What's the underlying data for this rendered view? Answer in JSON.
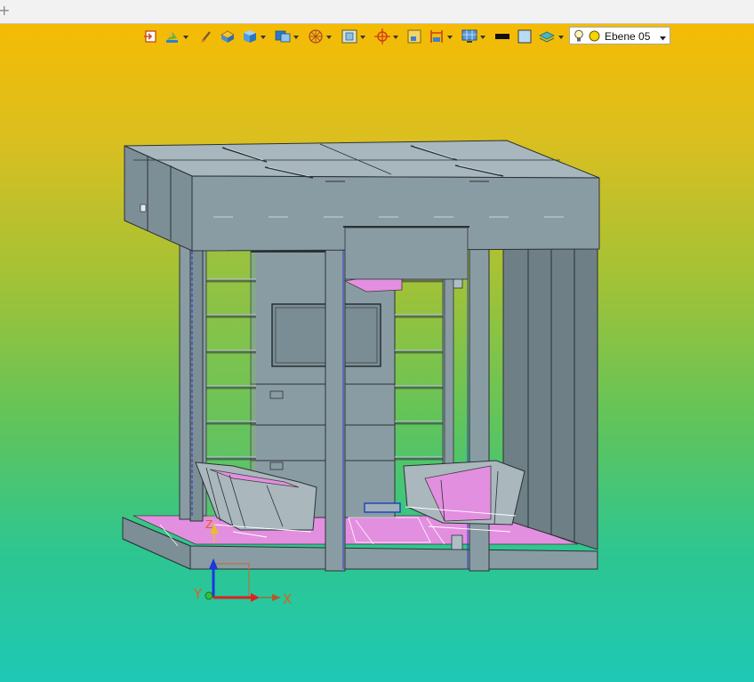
{
  "window": {
    "tab_plus_symbol": "+"
  },
  "toolbar": {
    "tools": [
      {
        "icon": "import-icon",
        "has_dropdown": false
      },
      {
        "icon": "palette-icon",
        "has_dropdown": true
      },
      {
        "icon": "brush-icon",
        "has_dropdown": false
      },
      {
        "icon": "layer-box-icon",
        "has_dropdown": false
      },
      {
        "icon": "cube-icon",
        "has_dropdown": true
      },
      {
        "icon": "view-cube-icon",
        "has_dropdown": true
      },
      {
        "icon": "sphere-grid-icon",
        "has_dropdown": true
      },
      {
        "icon": "box-select-icon",
        "has_dropdown": true
      },
      {
        "icon": "target-icon",
        "has_dropdown": true
      },
      {
        "icon": "snap-frame-icon",
        "has_dropdown": false
      },
      {
        "icon": "dimension-icon",
        "has_dropdown": true
      },
      {
        "icon": "monitor-grid-icon",
        "has_dropdown": true
      },
      {
        "icon": "line-color-icon",
        "has_dropdown": false
      },
      {
        "icon": "fill-color-icon",
        "has_dropdown": false
      },
      {
        "icon": "layer-stack-icon",
        "has_dropdown": true
      }
    ],
    "layer_select": {
      "value": "Ebene 05",
      "bulb_icon": "lightbulb-icon",
      "color_icon": "layer-color-icon",
      "color": "#f5d400"
    }
  },
  "viewport": {
    "gradient_top": "#f5bb04",
    "gradient_bottom": "#1ec8b4",
    "model_colors": {
      "steel": "#8a9ca3",
      "steel_dark": "#6e7f86",
      "highlight": "#e38fe0"
    },
    "triad": {
      "x_label": "X",
      "y_label": "Y",
      "z_label": "Z"
    }
  }
}
